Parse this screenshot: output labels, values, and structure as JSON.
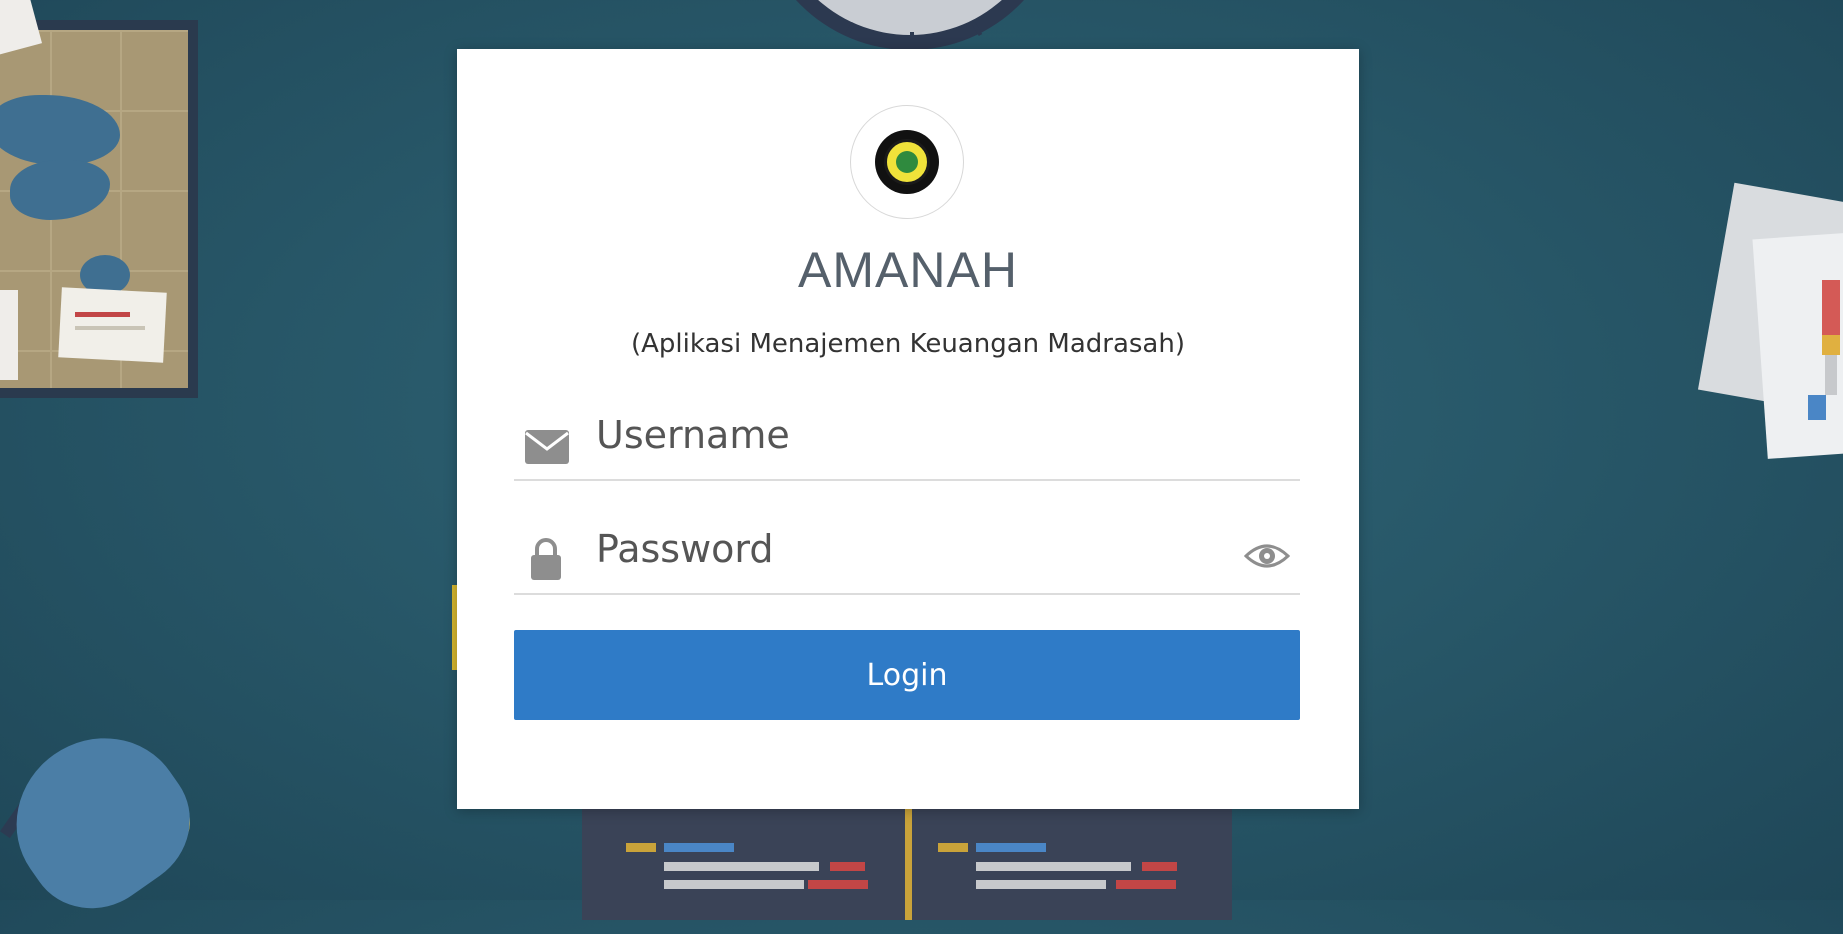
{
  "app": {
    "title": "AMANAH",
    "subtitle": "(Aplikasi Menajemen Keuangan Madrasah)"
  },
  "form": {
    "username_placeholder": "Username",
    "username_value": "",
    "password_placeholder": "Password",
    "password_value": "",
    "login_label": "Login"
  },
  "icons": {
    "logo": "madrasah-seal-logo",
    "username": "envelope-icon",
    "password": "lock-icon",
    "show_password": "eye-icon"
  },
  "colors": {
    "background": "#2a5b6c",
    "card": "#ffffff",
    "login_button": "#2f7bc7",
    "title_text": "#55606b"
  }
}
